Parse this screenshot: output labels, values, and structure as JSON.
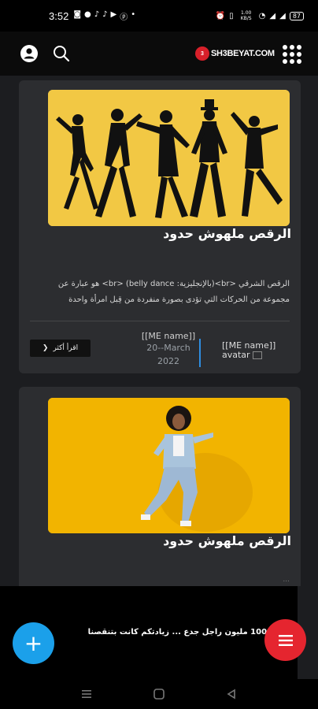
{
  "status_bar": {
    "time": "3:52",
    "left_icons": [
      "notification-icon",
      "messenger-icon",
      "tiktok-icon",
      "tiktok-icon",
      "youtube-icon",
      "pinterest-icon",
      "dot-icon"
    ],
    "right_icons": [
      "alarm-icon",
      "vibrate-icon",
      "data-rate-icon",
      "wifi-icon",
      "signal-icon",
      "signal-icon"
    ],
    "data_rate": "1.00 KB/S",
    "battery": "87"
  },
  "header": {
    "logo_badge": "3",
    "logo_text": "SH3BEYAT.COM",
    "icons": [
      "user-icon",
      "search-icon",
      "apps-grid-icon"
    ]
  },
  "posts": [
    {
      "title": "الرقص ملهوش حدود",
      "excerpt": "الرقص الشرقي <br>(بالإنجليزية: belly dance) <br> هو عبارة عن مجموعة من الحركات التي تؤدى بصورة منفردة من قِبل امرأة واحدة",
      "read_more": "اقرأ أكثر",
      "author_name": "[[ME name]]",
      "date_line1": "20--March",
      "date_line2": "2022",
      "avatar_alt": "[[ME name]] avatar"
    },
    {
      "title": "الرقص ملهوش حدود",
      "faint_text": "..."
    }
  ],
  "notification": {
    "text": "ات 100 مليون راجل جدع ... زيادتكم كانت بتنقصنا"
  },
  "fab": {
    "add_label": "+",
    "menu_icon": "hamburger-icon"
  },
  "nav_bar": {
    "icons": [
      "recent-apps-icon",
      "home-icon",
      "back-icon"
    ]
  },
  "colors": {
    "background": "#1c1d20",
    "card": "#2c2d30",
    "accent_blue": "#1ba0ea",
    "accent_red": "#e5252f",
    "image1_yellow": "#f2c844",
    "image2_yellow": "#f2b400"
  }
}
